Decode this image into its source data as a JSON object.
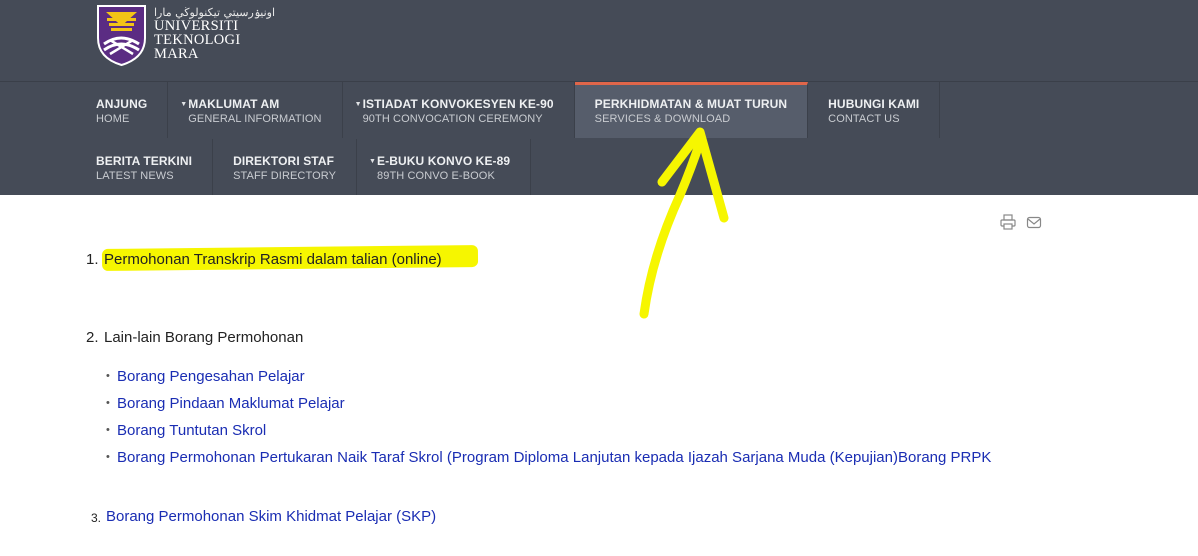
{
  "logo": {
    "jawi": "اونيۏرسيتي تيكنولوڬي مارا",
    "line1": "UNIVERSITI",
    "line2": "TEKNOLOGI",
    "line3": "MARA"
  },
  "nav": {
    "row1": [
      {
        "main": "ANJUNG",
        "sub": "HOME"
      },
      {
        "main": "MAKLUMAT AM",
        "sub": "GENERAL INFORMATION"
      },
      {
        "main": "ISTIADAT KONVOKESYEN KE-90",
        "sub": "90TH CONVOCATION CEREMONY"
      },
      {
        "main": "PERKHIDMATAN & MUAT TURUN",
        "sub": "SERVICES & DOWNLOAD"
      },
      {
        "main": "HUBUNGI KAMI",
        "sub": "CONTACT US"
      }
    ],
    "row2": [
      {
        "main": "BERITA TERKINI",
        "sub": "LATEST NEWS"
      },
      {
        "main": "DIREKTORI STAF",
        "sub": "STAFF DIRECTORY"
      },
      {
        "main": "E-BUKU KONVO KE-89",
        "sub": "89TH CONVO E-BOOK"
      }
    ]
  },
  "tools": {
    "print_icon": "printer-icon",
    "email_icon": "email-icon"
  },
  "content": {
    "item1_num": "1.",
    "item1": "Permohonan Transkrip Rasmi dalam talian (online)",
    "item2_num": "2.",
    "item2": "Lain-lain Borang Permohonan",
    "links": [
      "Borang Pengesahan Pelajar",
      "Borang Pindaan Maklumat Pelajar",
      "Borang Tuntutan Skrol",
      "Borang Permohonan Pertukaran Naik Taraf Skrol (Program Diploma Lanjutan kepada Ijazah Sarjana Muda (Kepujian)Borang PRPK"
    ],
    "item3_num": "3.",
    "item3": "Borang Permohonan Skim Khidmat Pelajar (SKP)"
  },
  "colors": {
    "header": "#454b57",
    "active_tab": "#565d6b",
    "accent": "#e0664a",
    "link": "#1a2db3",
    "highlight": "#f6f600"
  }
}
